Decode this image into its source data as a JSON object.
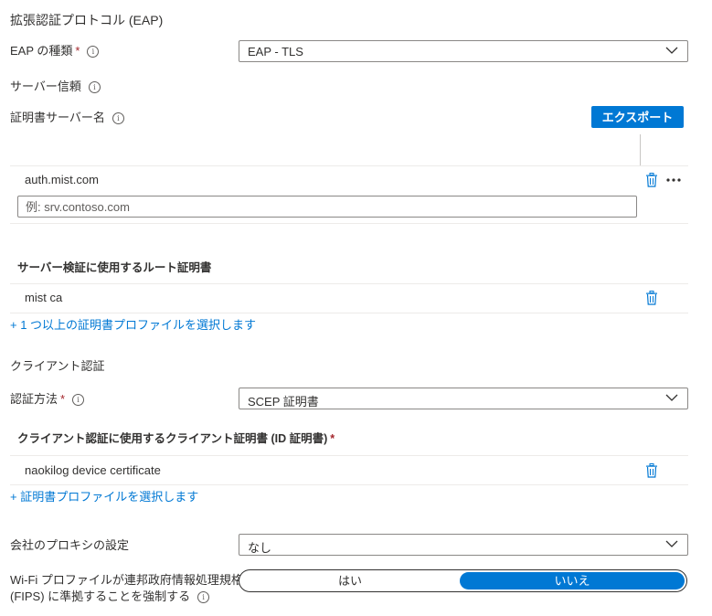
{
  "eap_section": {
    "heading": "拡張認証プロトコル (EAP)",
    "eap_type_label": "EAP の種類",
    "eap_type_value": "EAP - TLS",
    "server_trust_label": "サーバー信頼",
    "cert_server_names_label": "証明書サーバー名",
    "export_button": "エクスポート",
    "server_names": [
      "auth.mist.com"
    ],
    "server_name_placeholder": "例: srv.contoso.com",
    "root_cert_heading": "サーバー検証に使用するルート証明書",
    "root_certs": [
      "mist ca"
    ],
    "add_root_cert_link": "+ 1 つ以上の証明書プロファイルを選択します"
  },
  "client_auth": {
    "heading": "クライアント認証",
    "method_label": "認証方法",
    "method_value": "SCEP 証明書",
    "client_cert_heading": "クライアント認証に使用するクライアント証明書 (ID 証明書)",
    "client_certs": [
      "naokilog device certificate"
    ],
    "select_cert_link": "+ 証明書プロファイルを選択します"
  },
  "proxy": {
    "label": "会社のプロキシの設定",
    "value": "なし"
  },
  "fips": {
    "label_line1": "Wi-Fi プロファイルが連邦政府情報処理規格",
    "label_line2": "(FIPS) に準拠することを強制する",
    "option_yes": "はい",
    "option_no": "いいえ",
    "selected": "いいえ"
  },
  "colors": {
    "accent": "#0078d4",
    "required": "#a4262c",
    "text": "#323130",
    "divider": "#edebe9"
  },
  "icons": {
    "info": "info-circle-icon",
    "trash": "trash-icon",
    "chevron": "chevron-down-icon",
    "more": "more-dots-icon"
  }
}
